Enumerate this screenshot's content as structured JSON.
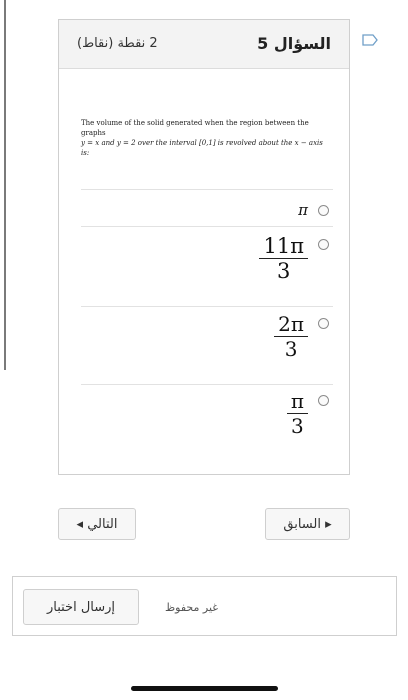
{
  "question": {
    "title": "السؤال 5",
    "points": "2 نقطة (نقاط)",
    "text_line1": "The volume of the solid generated when the region between the graphs",
    "text_line2": "y = x and y = 2 over the interval [0,1] is revolved about the x − axis is:",
    "options": [
      {
        "label": "π"
      },
      {
        "numerator": "11π",
        "denominator": "3"
      },
      {
        "numerator": "2π",
        "denominator": "3"
      },
      {
        "numerator": "π",
        "denominator": "3"
      }
    ]
  },
  "nav": {
    "next_label": "التالي ◂",
    "prev_label": "▸ السابق"
  },
  "footer": {
    "status": "غير محفوظ",
    "submit_label": "إرسال اختبار"
  },
  "icons": {
    "flag": "flag-icon",
    "radio": "radio-button"
  }
}
